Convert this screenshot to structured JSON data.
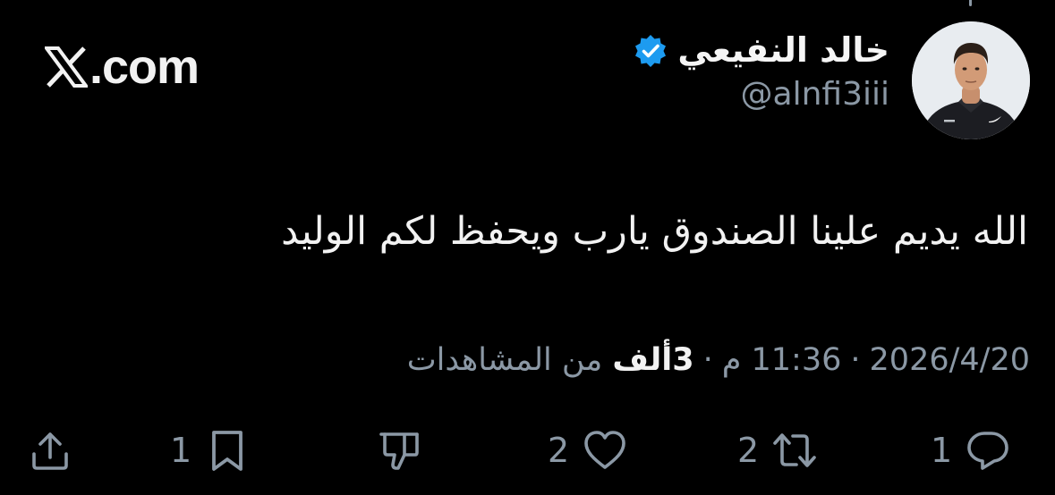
{
  "site": {
    "name": ".com",
    "icon": "x-logo-icon"
  },
  "author": {
    "display_name": "خالد النفيعي",
    "handle": "@alnfi3iii",
    "verified": true,
    "avatar_icon": "avatar-photo"
  },
  "tweet": {
    "text": "الله يديم علينا الصندوق يارب ويحفظ لكم الوليد"
  },
  "meta": {
    "date": "2026/4/20",
    "separator": "·",
    "time": "11:36 م",
    "views_count": "3ألف",
    "views_label": "من المشاهدات"
  },
  "actions": {
    "reply": {
      "icon": "reply-icon",
      "count": "1"
    },
    "repost": {
      "icon": "repost-icon",
      "count": "2"
    },
    "like": {
      "icon": "heart-icon",
      "count": "2"
    },
    "dislike": {
      "icon": "dislike-icon",
      "count": ""
    },
    "bookmark": {
      "icon": "bookmark-icon",
      "count": "1"
    },
    "share": {
      "icon": "share-icon",
      "count": ""
    }
  },
  "colors": {
    "background": "#000000",
    "text": "#e7e9ea",
    "secondary_text": "#8b98a5",
    "verified_badge": "#1d9bf0"
  }
}
